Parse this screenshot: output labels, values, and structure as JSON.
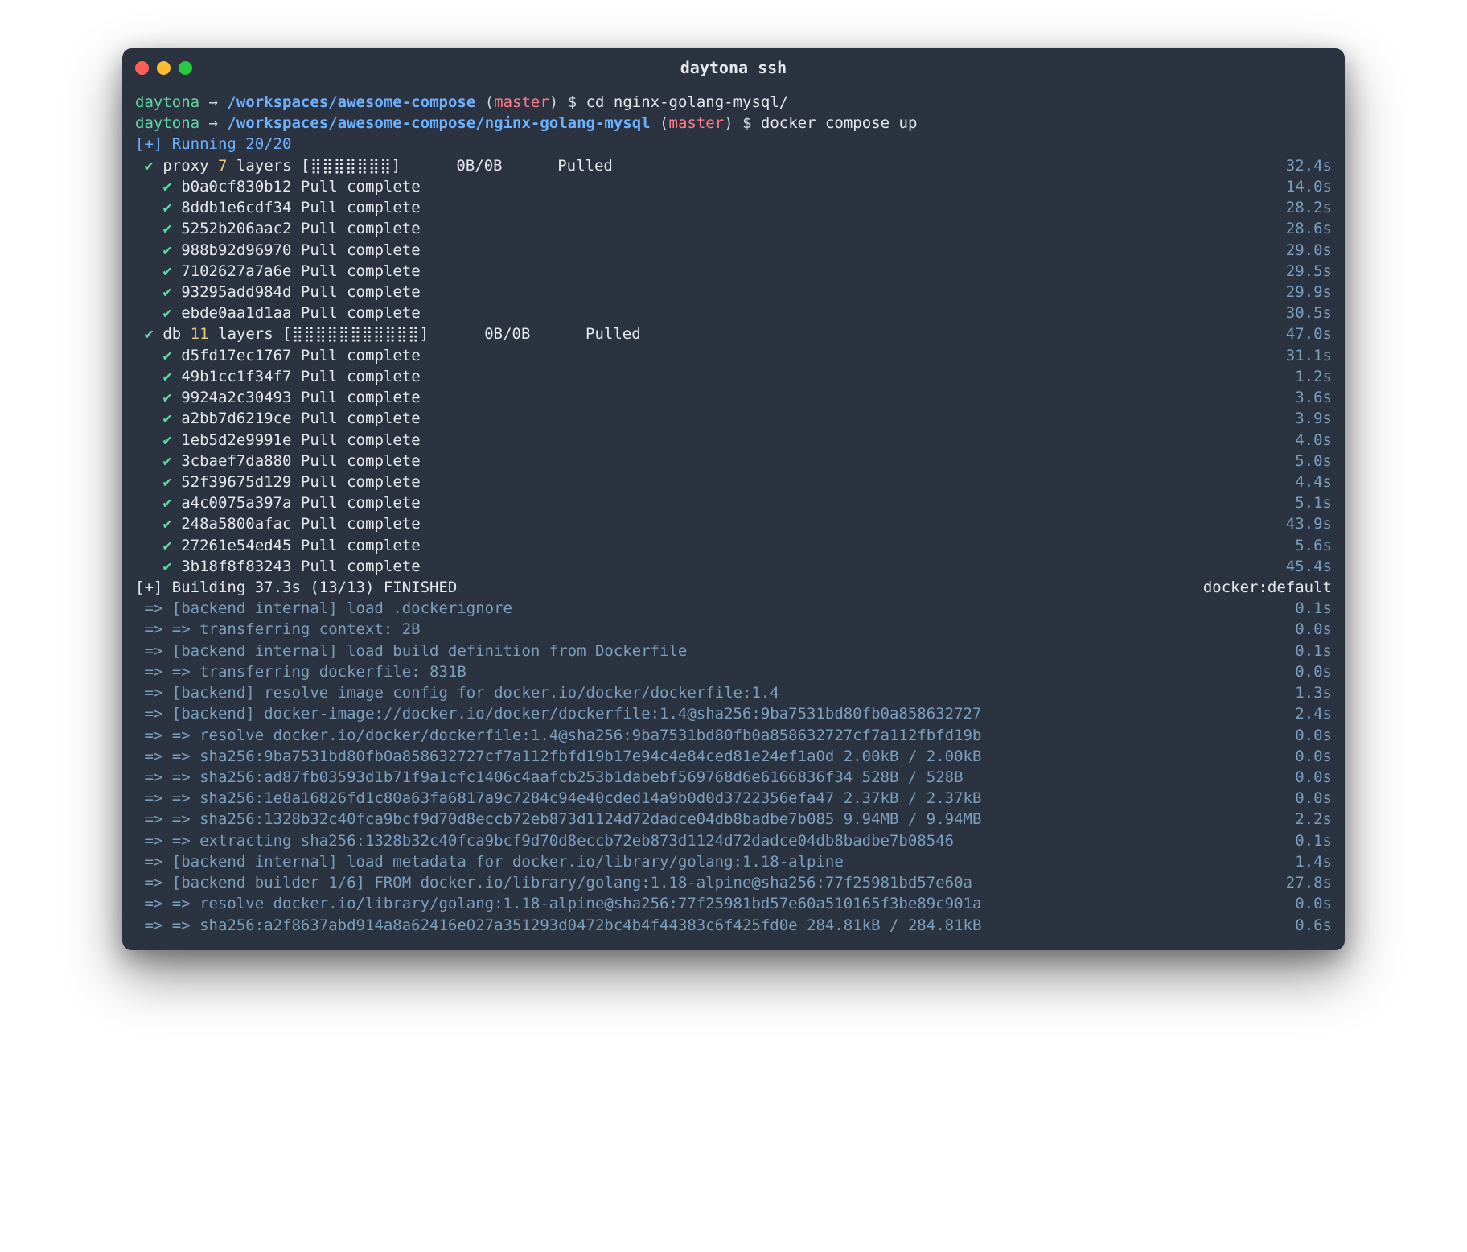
{
  "title": "daytona ssh",
  "prompts": [
    {
      "host": "daytona",
      "path": "/workspaces/awesome-compose",
      "branch": "master",
      "command": "cd nginx-golang-mysql/"
    },
    {
      "host": "daytona",
      "path": "/workspaces/awesome-compose/nginx-golang-mysql",
      "branch": "master",
      "command": "docker compose up"
    }
  ],
  "running": {
    "prefix": "[+]",
    "text": "Running 20/20"
  },
  "services": [
    {
      "name": "proxy",
      "layers": "7",
      "bar": "[⣿⣿⣿⣿⣿⣿⣿]",
      "size": "0B/0B",
      "status": "Pulled",
      "time": "32.4s",
      "pulls": [
        {
          "hash": "b0a0cf830b12",
          "status": "Pull complete",
          "time": "14.0s"
        },
        {
          "hash": "8ddb1e6cdf34",
          "status": "Pull complete",
          "time": "28.2s"
        },
        {
          "hash": "5252b206aac2",
          "status": "Pull complete",
          "time": "28.6s"
        },
        {
          "hash": "988b92d96970",
          "status": "Pull complete",
          "time": "29.0s"
        },
        {
          "hash": "7102627a7a6e",
          "status": "Pull complete",
          "time": "29.5s"
        },
        {
          "hash": "93295add984d",
          "status": "Pull complete",
          "time": "29.9s"
        },
        {
          "hash": "ebde0aa1d1aa",
          "status": "Pull complete",
          "time": "30.5s"
        }
      ]
    },
    {
      "name": "db",
      "layers": "11",
      "bar": "[⣿⣿⣿⣿⣿⣿⣿⣿⣿⣿⣿]",
      "size": "0B/0B",
      "status": "Pulled",
      "time": "47.0s",
      "pulls": [
        {
          "hash": "d5fd17ec1767",
          "status": "Pull complete",
          "time": "31.1s"
        },
        {
          "hash": "49b1cc1f34f7",
          "status": "Pull complete",
          "time": "1.2s"
        },
        {
          "hash": "9924a2c30493",
          "status": "Pull complete",
          "time": "3.6s"
        },
        {
          "hash": "a2bb7d6219ce",
          "status": "Pull complete",
          "time": "3.9s"
        },
        {
          "hash": "1eb5d2e9991e",
          "status": "Pull complete",
          "time": "4.0s"
        },
        {
          "hash": "3cbaef7da880",
          "status": "Pull complete",
          "time": "5.0s"
        },
        {
          "hash": "52f39675d129",
          "status": "Pull complete",
          "time": "4.4s"
        },
        {
          "hash": "a4c0075a397a",
          "status": "Pull complete",
          "time": "5.1s"
        },
        {
          "hash": "248a5800afac",
          "status": "Pull complete",
          "time": "43.9s"
        },
        {
          "hash": "27261e54ed45",
          "status": "Pull complete",
          "time": "5.6s"
        },
        {
          "hash": "3b18f8f83243",
          "status": "Pull complete",
          "time": "45.4s"
        }
      ]
    }
  ],
  "building": {
    "prefix": "[+]",
    "text": "Building 37.3s (13/13) FINISHED",
    "right": "docker:default"
  },
  "build_steps": [
    {
      "text": " => [backend internal] load .dockerignore",
      "time": "0.1s"
    },
    {
      "text": " => => transferring context: 2B",
      "time": "0.0s"
    },
    {
      "text": " => [backend internal] load build definition from Dockerfile",
      "time": "0.1s"
    },
    {
      "text": " => => transferring dockerfile: 831B",
      "time": "0.0s"
    },
    {
      "text": " => [backend] resolve image config for docker.io/docker/dockerfile:1.4",
      "time": "1.3s"
    },
    {
      "text": " => [backend] docker-image://docker.io/docker/dockerfile:1.4@sha256:9ba7531bd80fb0a858632727",
      "time": "2.4s"
    },
    {
      "text": " => => resolve docker.io/docker/dockerfile:1.4@sha256:9ba7531bd80fb0a858632727cf7a112fbfd19b",
      "time": "0.0s"
    },
    {
      "text": " => => sha256:9ba7531bd80fb0a858632727cf7a112fbfd19b17e94c4e84ced81e24ef1a0d 2.00kB / 2.00kB",
      "time": "0.0s"
    },
    {
      "text": " => => sha256:ad87fb03593d1b71f9a1cfc1406c4aafcb253b1dabebf569768d6e6166836f34 528B / 528B",
      "time": "0.0s"
    },
    {
      "text": " => => sha256:1e8a16826fd1c80a63fa6817a9c7284c94e40cded14a9b0d0d3722356efa47 2.37kB / 2.37kB",
      "time": "0.0s"
    },
    {
      "text": " => => sha256:1328b32c40fca9bcf9d70d8eccb72eb873d1124d72dadce04db8badbe7b085 9.94MB / 9.94MB",
      "time": "2.2s"
    },
    {
      "text": " => => extracting sha256:1328b32c40fca9bcf9d70d8eccb72eb873d1124d72dadce04db8badbe7b08546",
      "time": "0.1s"
    },
    {
      "text": " => [backend internal] load metadata for docker.io/library/golang:1.18-alpine",
      "time": "1.4s"
    },
    {
      "text": " => [backend builder 1/6] FROM docker.io/library/golang:1.18-alpine@sha256:77f25981bd57e60a",
      "time": "27.8s"
    },
    {
      "text": " => => resolve docker.io/library/golang:1.18-alpine@sha256:77f25981bd57e60a510165f3be89c901a",
      "time": "0.0s"
    },
    {
      "text": " => => sha256:a2f8637abd914a8a62416e027a351293d0472bc4b4f44383c6f425fd0e 284.81kB / 284.81kB",
      "time": "0.6s"
    }
  ]
}
